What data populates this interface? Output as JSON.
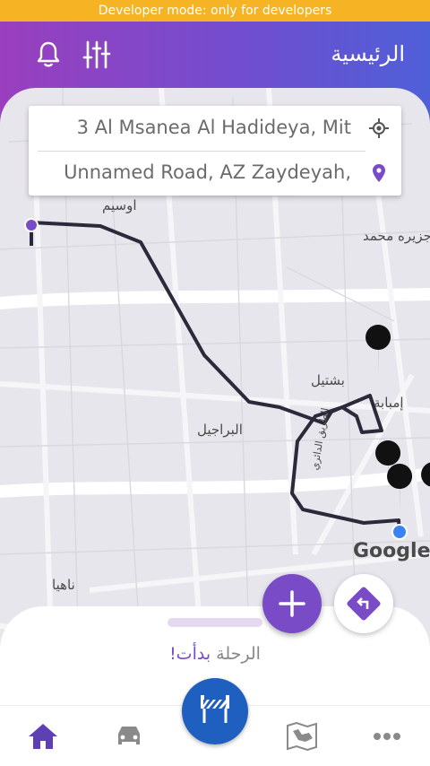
{
  "status_banner": "Developer mode: only for developers",
  "header": {
    "title": "الرئيسية",
    "icons": [
      "bell-icon",
      "sliders-icon"
    ]
  },
  "route": {
    "origin": "3 Al Msanea Al Hadideya, Mit",
    "destination": "Unnamed Road, AZ Zaydeyah,",
    "origin_icon": "my-location-icon",
    "destination_icon": "location-pin-icon"
  },
  "map": {
    "labels": [
      "اوسيم",
      "جزيره محمد",
      "بشتيل",
      "إمبابة",
      "البراجيل",
      "الطريق الدائري",
      "ناهيا"
    ],
    "attribution": "Google"
  },
  "trip": {
    "label": "الرحلة",
    "status": "بدأت!"
  },
  "nav": {
    "items": [
      "home-icon",
      "car-icon",
      "roadblock-icon",
      "map-icon",
      "more-icon"
    ]
  },
  "colors": {
    "accent": "#7a4bc7",
    "banner": "#f6b323",
    "center_button": "#1f5fbf"
  }
}
